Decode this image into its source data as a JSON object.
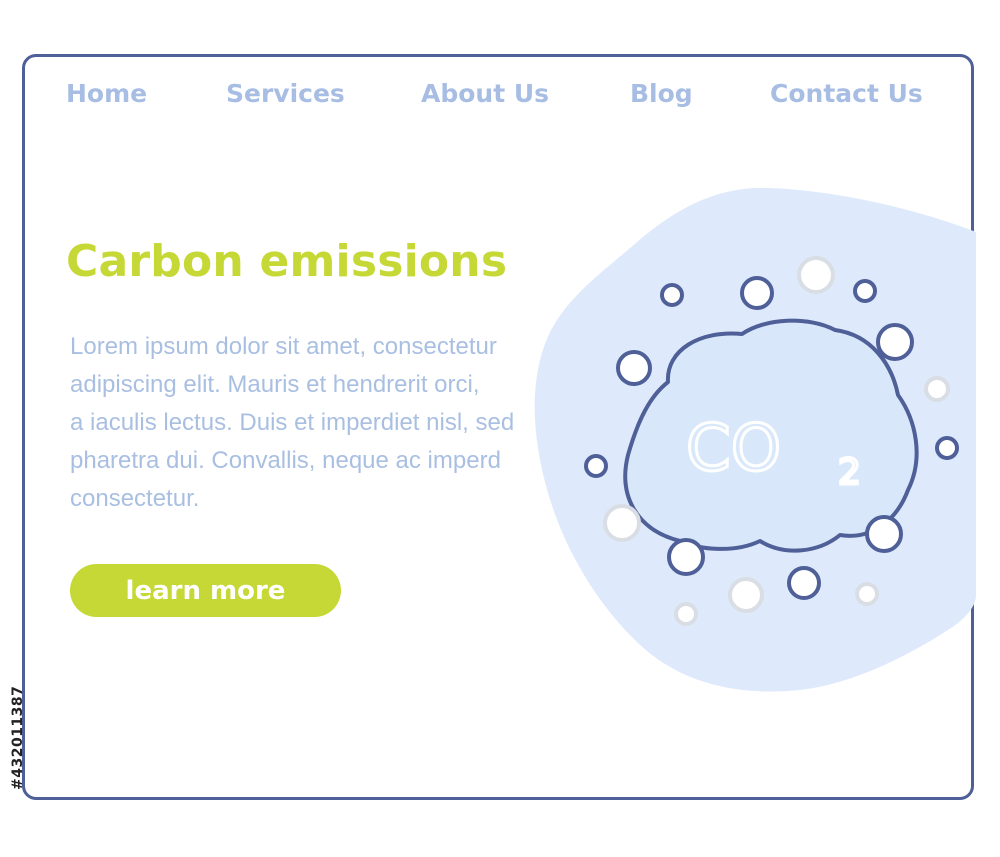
{
  "nav": {
    "items": [
      {
        "label": "Home"
      },
      {
        "label": "Services"
      },
      {
        "label": "About Us"
      },
      {
        "label": "Blog"
      },
      {
        "label": "Contact Us"
      }
    ]
  },
  "hero": {
    "title": "Carbon emissions",
    "body_lines": [
      "Lorem ipsum dolor sit amet, consectetur",
      "adipiscing elit. Mauris et hendrerit orci,",
      "a iaculis lectus. Duis et imperdiet nisl, sed",
      "pharetra dui. Convallis, neque ac imperd",
      "consectetur."
    ],
    "cta_label": "learn more"
  },
  "illustration": {
    "co2_text": "CO",
    "co2_subscript": "2",
    "icon": "co2-cloud-icon"
  },
  "stock_id": "#432011387",
  "colors": {
    "frame": "#4f5f98",
    "nav_text": "#a7bde3",
    "accent_green": "#c6d836",
    "body_text": "#a9bfe2",
    "blob": "#deeafb",
    "cloud_fill": "#d8e8fa",
    "circle_stroke": "#4f5f98",
    "faded_circle": "#d9dde4"
  }
}
